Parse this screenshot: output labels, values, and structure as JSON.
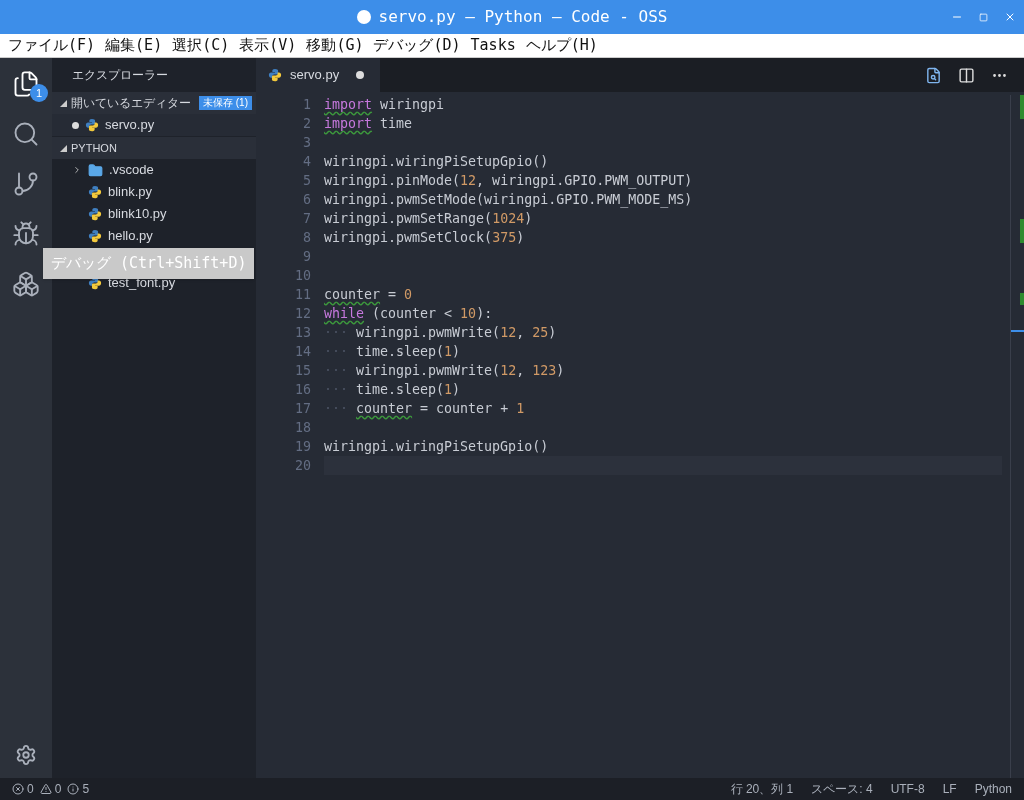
{
  "window": {
    "title": "servo.py — Python — Code - OSS",
    "dirty": true
  },
  "menu": [
    "ファイル(F)",
    "編集(E)",
    "選択(C)",
    "表示(V)",
    "移動(G)",
    "デバッグ(D)",
    "Tasks",
    "ヘルプ(H)"
  ],
  "activity_bar": {
    "badge": "1",
    "items": [
      {
        "kind": "files",
        "selected": true
      },
      {
        "kind": "search",
        "selected": false
      },
      {
        "kind": "git",
        "selected": false
      },
      {
        "kind": "debug",
        "selected": false
      },
      {
        "kind": "extensions",
        "selected": false
      }
    ]
  },
  "tooltip": "デバッグ (Ctrl+Shift+D)",
  "sidebar": {
    "title": "エクスプローラー",
    "open_editors": {
      "label": "開いているエディター",
      "badge": "未保存 (1)",
      "expanded": true,
      "items": [
        {
          "name": "servo.py",
          "dirty": true
        }
      ]
    },
    "folder": {
      "label": "PYTHON",
      "expanded": true,
      "items": [
        {
          "name": ".vscode",
          "kind": "folder",
          "expanded": false
        },
        {
          "name": "blink.py",
          "kind": "python"
        },
        {
          "name": "blink10.py",
          "kind": "python"
        },
        {
          "name": "hello.py",
          "kind": "python"
        },
        {
          "name": "test_font.py",
          "kind": "python"
        }
      ]
    }
  },
  "tab": {
    "label": "servo.py",
    "dirty": true,
    "selected": true
  },
  "code": [
    {
      "selected": false,
      "tokens": [
        {
          "text": "import",
          "kind": "keyword",
          "squiggle": true
        },
        {
          "text": " wiringpi",
          "kind": "plain",
          "squiggle": false
        }
      ]
    },
    {
      "selected": false,
      "tokens": [
        {
          "text": "import",
          "kind": "keyword",
          "squiggle": true
        },
        {
          "text": " time",
          "kind": "plain",
          "squiggle": false
        }
      ]
    },
    {
      "selected": false
    },
    {
      "selected": false,
      "tokens": [
        {
          "text": "wiringpi.wiringPiSetupGpio()",
          "kind": "plain",
          "squiggle": false
        }
      ]
    },
    {
      "selected": false,
      "tokens": [
        {
          "text": "wiringpi.pinMode(",
          "kind": "plain",
          "squiggle": false
        },
        {
          "text": "12",
          "kind": "number",
          "squiggle": false
        },
        {
          "text": ", wiringpi.GPIO.PWM_OUTPUT)",
          "kind": "plain",
          "squiggle": false
        }
      ]
    },
    {
      "selected": false,
      "tokens": [
        {
          "text": "wiringpi.pwmSetMode(wiringpi.GPIO.PWM_MODE_MS)",
          "kind": "plain",
          "squiggle": false
        }
      ]
    },
    {
      "selected": false,
      "tokens": [
        {
          "text": "wiringpi.pwmSetRange(",
          "kind": "plain",
          "squiggle": false
        },
        {
          "text": "1024",
          "kind": "number",
          "squiggle": false
        },
        {
          "text": ")",
          "kind": "plain",
          "squiggle": false
        }
      ]
    },
    {
      "selected": false,
      "tokens": [
        {
          "text": "wiringpi.pwmSetClock(",
          "kind": "plain",
          "squiggle": false
        },
        {
          "text": "375",
          "kind": "number",
          "squiggle": false
        },
        {
          "text": ")",
          "kind": "plain",
          "squiggle": false
        }
      ]
    },
    {
      "selected": false
    },
    {
      "selected": false
    },
    {
      "selected": false,
      "tokens": [
        {
          "text": "counter",
          "kind": "plain",
          "squiggle": true
        },
        {
          "text": " = ",
          "kind": "plain",
          "squiggle": false
        },
        {
          "text": "0",
          "kind": "number",
          "squiggle": false
        }
      ]
    },
    {
      "selected": false,
      "tokens": [
        {
          "text": "while",
          "kind": "keyword",
          "squiggle": true
        },
        {
          "text": " (counter < ",
          "kind": "plain",
          "squiggle": false
        },
        {
          "text": "10",
          "kind": "number",
          "squiggle": false
        },
        {
          "text": "):",
          "kind": "plain",
          "squiggle": false
        }
      ]
    },
    {
      "selected": false,
      "tokens": [
        {
          "text": "···",
          "kind": "whitespace",
          "squiggle": false
        },
        {
          "text": "wiringpi.pwmWrite(",
          "kind": "plain",
          "squiggle": false
        },
        {
          "text": "12",
          "kind": "number",
          "squiggle": false
        },
        {
          "text": ", ",
          "kind": "plain",
          "squiggle": false
        },
        {
          "text": "25",
          "kind": "number",
          "squiggle": false
        },
        {
          "text": ")",
          "kind": "plain",
          "squiggle": false
        }
      ]
    },
    {
      "selected": false,
      "tokens": [
        {
          "text": "···",
          "kind": "whitespace",
          "squiggle": false
        },
        {
          "text": "time.sleep(",
          "kind": "plain",
          "squiggle": false
        },
        {
          "text": "1",
          "kind": "number",
          "squiggle": false
        },
        {
          "text": ")",
          "kind": "plain",
          "squiggle": false
        }
      ]
    },
    {
      "selected": false,
      "tokens": [
        {
          "text": "···",
          "kind": "whitespace",
          "squiggle": false
        },
        {
          "text": "wiringpi.pwmWrite(",
          "kind": "plain",
          "squiggle": false
        },
        {
          "text": "12",
          "kind": "number",
          "squiggle": false
        },
        {
          "text": ", ",
          "kind": "plain",
          "squiggle": false
        },
        {
          "text": "123",
          "kind": "number",
          "squiggle": false
        },
        {
          "text": ")",
          "kind": "plain",
          "squiggle": false
        }
      ]
    },
    {
      "selected": false,
      "tokens": [
        {
          "text": "···",
          "kind": "whitespace",
          "squiggle": false
        },
        {
          "text": "time.sleep(",
          "kind": "plain",
          "squiggle": false
        },
        {
          "text": "1",
          "kind": "number",
          "squiggle": false
        },
        {
          "text": ")",
          "kind": "plain",
          "squiggle": false
        }
      ]
    },
    {
      "selected": false,
      "tokens": [
        {
          "text": "···",
          "kind": "whitespace",
          "squiggle": false
        },
        {
          "text": "counter",
          "kind": "plain",
          "squiggle": true
        },
        {
          "text": " = counter + ",
          "kind": "plain",
          "squiggle": false
        },
        {
          "text": "1",
          "kind": "number",
          "squiggle": false
        }
      ]
    },
    {
      "selected": false
    },
    {
      "selected": false,
      "tokens": [
        {
          "text": "wiringpi.wiringPiSetupGpio()",
          "kind": "plain",
          "squiggle": false
        }
      ]
    },
    {
      "selected": true
    }
  ],
  "line_numbers": [
    "1",
    "2",
    "3",
    "4",
    "5",
    "6",
    "7",
    "8",
    "9",
    "10",
    "11",
    "12",
    "13",
    "14",
    "15",
    "16",
    "17",
    "18",
    "19",
    "20"
  ],
  "status_bar": {
    "problems": [
      {
        "kind": "error",
        "count": "0"
      },
      {
        "kind": "warning",
        "count": "0"
      },
      {
        "kind": "info",
        "count": "5"
      }
    ],
    "items": [
      "行 20、列 1",
      "スペース: 4",
      "UTF-8",
      "LF",
      "Python"
    ]
  }
}
